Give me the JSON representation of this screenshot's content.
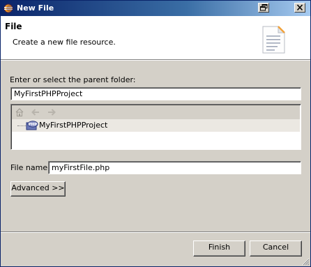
{
  "window": {
    "title": "New File"
  },
  "header": {
    "title": "File",
    "description": "Create a new file resource."
  },
  "parent_folder": {
    "label": "Enter or select the parent folder:",
    "value": "MyFirstPHPProject"
  },
  "tree": {
    "items": [
      {
        "label": "MyFirstPHPProject",
        "icon": "php-project-icon",
        "selected": true
      }
    ]
  },
  "file_name": {
    "label": "File name:",
    "value": "myFirstFile.php"
  },
  "buttons": {
    "advanced": "Advanced >>",
    "finish": "Finish",
    "cancel": "Cancel"
  },
  "colors": {
    "titlebar_start": "#0a246a",
    "titlebar_end": "#a6caf0",
    "dialog_bg": "#d4d0c8",
    "selection_bg": "#ebe8e2"
  }
}
